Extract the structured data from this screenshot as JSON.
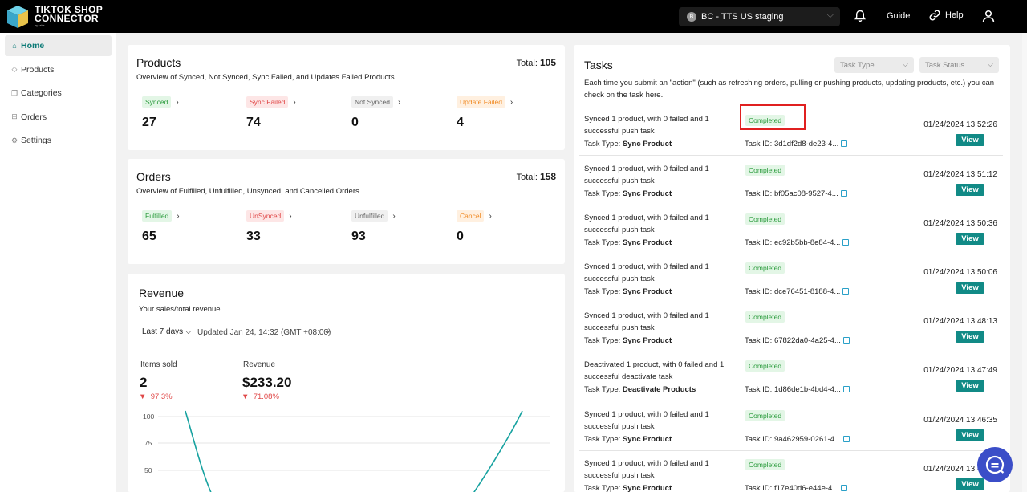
{
  "header": {
    "brand_line1": "TIKTOK SHOP",
    "brand_line2": "CONNECTOR",
    "brand_sub": "by labs",
    "store": "BC - TTS US staging",
    "store_initial": "B",
    "guide": "Guide",
    "help": "Help"
  },
  "sidebar": {
    "items": [
      {
        "label": "Home",
        "icon": "home-icon"
      },
      {
        "label": "Products",
        "icon": "tag-icon"
      },
      {
        "label": "Categories",
        "icon": "copy-icon"
      },
      {
        "label": "Orders",
        "icon": "cart-icon"
      },
      {
        "label": "Settings",
        "icon": "gear-icon"
      }
    ]
  },
  "products": {
    "title": "Products",
    "total_label": "Total:",
    "total": "105",
    "desc": "Overview of Synced, Not Synced, Sync Failed, and Updates Failed Products.",
    "stats": [
      {
        "label": "Synced",
        "value": "27"
      },
      {
        "label": "Sync Failed",
        "value": "74"
      },
      {
        "label": "Not Synced",
        "value": "0"
      },
      {
        "label": "Update Failed",
        "value": "4"
      }
    ]
  },
  "orders": {
    "title": "Orders",
    "total_label": "Total:",
    "total": "158",
    "desc": "Overview of Fulfilled, Unfulfilled, Unsynced, and Cancelled Orders.",
    "stats": [
      {
        "label": "Fulfilled",
        "value": "65"
      },
      {
        "label": "UnSynced",
        "value": "33"
      },
      {
        "label": "Unfulfilled",
        "value": "93"
      },
      {
        "label": "Cancel",
        "value": "0"
      }
    ]
  },
  "revenue": {
    "title": "Revenue",
    "desc": "Your sales/total revenue.",
    "range": "Last 7 days",
    "updated": "Updated Jan 24, 14:32 (GMT +08:00)",
    "items_label": "Items sold",
    "items_value": "2",
    "items_change": "97.3%",
    "revenue_label": "Revenue",
    "revenue_value": "$233.20",
    "revenue_change": "71.08%",
    "y_ticks": [
      "100",
      "75",
      "50"
    ]
  },
  "tasks": {
    "title": "Tasks",
    "filter_type": "Task Type",
    "filter_status": "Task Status",
    "desc": "Each time you submit an \"action\" (such as refreshing orders, pulling or pushing products, updating products, etc.) you can check on the task here.",
    "type_label": "Task Type:",
    "id_label": "Task ID:",
    "view_label": "View",
    "rows": [
      {
        "desc": "Synced 1 product, with 0 failed and 1 successful push task",
        "status": "Completed",
        "type": "Sync Product",
        "id": "3d1df2d8-de23-4...",
        "date": "01/24/2024 13:52:26"
      },
      {
        "desc": "Synced 1 product, with 0 failed and 1 successful push task",
        "status": "Completed",
        "type": "Sync Product",
        "id": "bf05ac08-9527-4...",
        "date": "01/24/2024 13:51:12"
      },
      {
        "desc": "Synced 1 product, with 0 failed and 1 successful push task",
        "status": "Completed",
        "type": "Sync Product",
        "id": "ec92b5bb-8e84-4...",
        "date": "01/24/2024 13:50:36"
      },
      {
        "desc": "Synced 1 product, with 0 failed and 1 successful push task",
        "status": "Completed",
        "type": "Sync Product",
        "id": "dce76451-8188-4...",
        "date": "01/24/2024 13:50:06"
      },
      {
        "desc": "Synced 1 product, with 0 failed and 1 successful push task",
        "status": "Completed",
        "type": "Sync Product",
        "id": "67822da0-4a25-4...",
        "date": "01/24/2024 13:48:13"
      },
      {
        "desc": "Deactivated 1 product, with 0 failed and 1 successful deactivate task",
        "status": "Completed",
        "type": "Deactivate Products",
        "id": "1d86de1b-4bd4-4...",
        "date": "01/24/2024 13:47:49"
      },
      {
        "desc": "Synced 1 product, with 0 failed and 1 successful push task",
        "status": "Completed",
        "type": "Sync Product",
        "id": "9a462959-0261-4...",
        "date": "01/24/2024 13:46:35"
      },
      {
        "desc": "Synced 1 product, with 0 failed and 1 successful push task",
        "status": "Completed",
        "type": "Sync Product",
        "id": "f17e40d6-e44e-4...",
        "date": "01/24/2024 13:46:23"
      }
    ]
  },
  "colors": {
    "accent": "#118a86",
    "topbar": "#000000",
    "highlight": "#e02020",
    "chat": "#3b4ec8"
  }
}
